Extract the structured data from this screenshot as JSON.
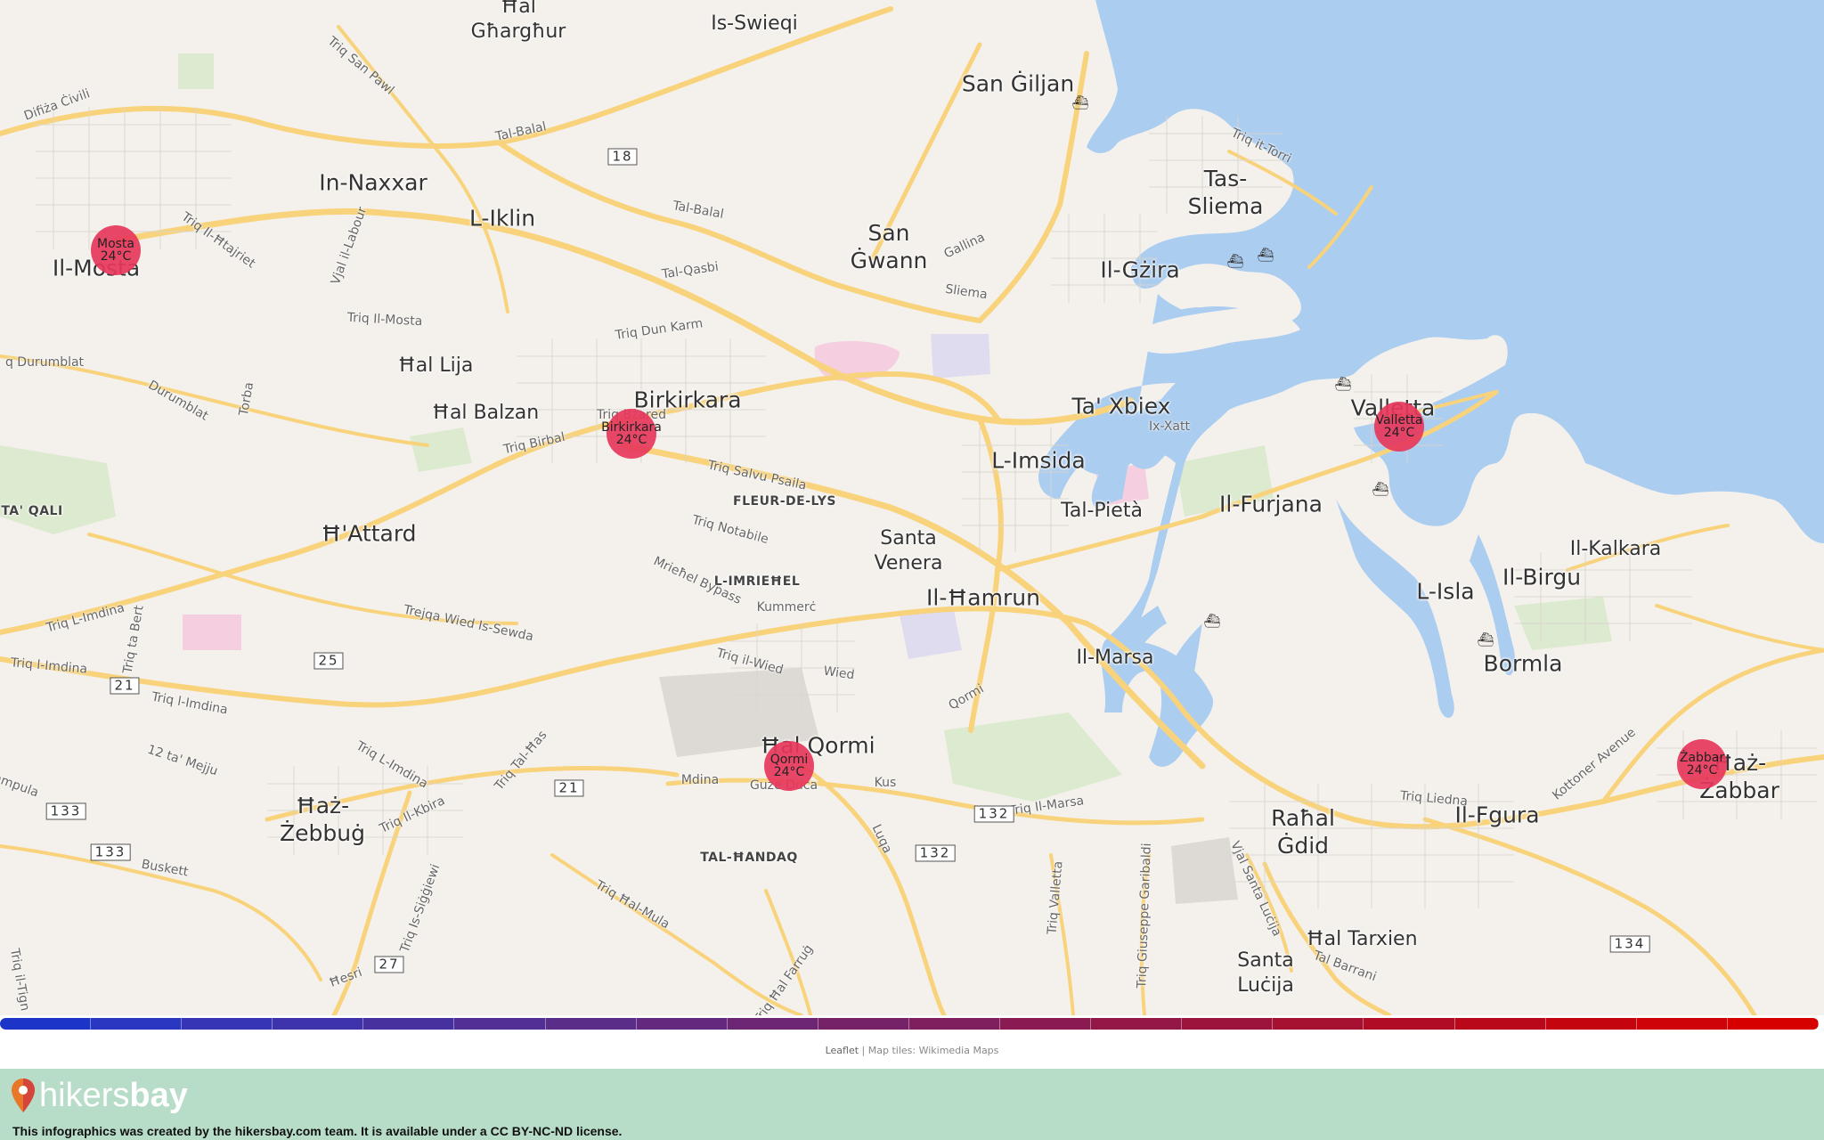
{
  "map": {
    "places": [
      {
        "id": "hal-gharghur",
        "text": "Ħal\nGħargħur",
        "size": "mid"
      },
      {
        "id": "is-swieqi",
        "text": "Is-Swieqi",
        "size": "mid"
      },
      {
        "id": "san-giljan",
        "text": "San Ġiljan",
        "size": "big"
      },
      {
        "id": "in-naxxar",
        "text": "In-Naxxar",
        "size": "big"
      },
      {
        "id": "l-iklin",
        "text": "L-Iklin",
        "size": "big"
      },
      {
        "id": "tas-sliema",
        "text": "Tas-\nSliema",
        "size": "big"
      },
      {
        "id": "san-gwann",
        "text": "San\nĠwann",
        "size": "big"
      },
      {
        "id": "il-gzira",
        "text": "Il-Gżira",
        "size": "big"
      },
      {
        "id": "il-mosta",
        "text": "Il-Mosta",
        "size": "big"
      },
      {
        "id": "hal-lija",
        "text": "Ħal Lija",
        "size": "mid"
      },
      {
        "id": "hal-balzan",
        "text": "Ħal Balzan",
        "size": "mid"
      },
      {
        "id": "birkirkara",
        "text": "Birkirkara",
        "size": "big"
      },
      {
        "id": "ta-xbiex",
        "text": "Ta' Xbiex",
        "size": "big"
      },
      {
        "id": "valletta",
        "text": "Valletta",
        "size": "big"
      },
      {
        "id": "l-imsida",
        "text": "L-Imsida",
        "size": "big"
      },
      {
        "id": "tal-pieta",
        "text": "Tal-Pietà",
        "size": "mid"
      },
      {
        "id": "il-furjana",
        "text": "Il-Furjana",
        "size": "big"
      },
      {
        "id": "h-attard",
        "text": "Ħ'Attard",
        "size": "big"
      },
      {
        "id": "santa-venera",
        "text": "Santa\nVenera",
        "size": "mid"
      },
      {
        "id": "il-hamrun",
        "text": "Il-Ħamrun",
        "size": "big"
      },
      {
        "id": "il-kalkara",
        "text": "Il-Kalkara",
        "size": "mid"
      },
      {
        "id": "il-birgu",
        "text": "Il-Birgu",
        "size": "big"
      },
      {
        "id": "l-isla",
        "text": "L-Isla",
        "size": "big"
      },
      {
        "id": "il-marsa",
        "text": "Il-Marsa",
        "size": "mid"
      },
      {
        "id": "bormla",
        "text": "Bormla",
        "size": "big"
      },
      {
        "id": "hal-qormi",
        "text": "Ħal Qormi",
        "size": "big"
      },
      {
        "id": "haz-zabbar",
        "text": "Ħaż-\nŻabbar",
        "size": "big"
      },
      {
        "id": "haz-zebbug",
        "text": "Ħaż-\nŻebbuġ",
        "size": "big"
      },
      {
        "id": "rahal-gdid",
        "text": "Raħal\nĠdid",
        "size": "big"
      },
      {
        "id": "il-fgura",
        "text": "Il-Fgura",
        "size": "big"
      },
      {
        "id": "hal-tarxien",
        "text": "Ħal Tarxien",
        "size": "mid"
      },
      {
        "id": "santa-lucija",
        "text": "Santa\nLuċija",
        "size": "mid"
      },
      {
        "id": "ta-qali",
        "text": "TA' QALI",
        "size": "small"
      },
      {
        "id": "fleur-de-lys",
        "text": "FLEUR-DE-LYS",
        "size": "small"
      },
      {
        "id": "l-imriehel",
        "text": "L-IMRIEĦEL",
        "size": "small"
      },
      {
        "id": "tal-handaq",
        "text": "TAL-ĦANDAQ",
        "size": "small"
      }
    ],
    "streets": [
      {
        "id": "difiza-civili",
        "text": "Difiża Ċivili",
        "rot": -20
      },
      {
        "id": "triq-san-pawl",
        "text": "Triq San Pawl",
        "rot": 40
      },
      {
        "id": "tal-balal-1",
        "text": "Tal-Balal",
        "rot": -12
      },
      {
        "id": "triq-it-torri",
        "text": "Triq it-Torri",
        "rot": 25
      },
      {
        "id": "triq-il-htajriet",
        "text": "Triq Il-Ħtajriet",
        "rot": 35
      },
      {
        "id": "vjal-il-labour",
        "text": "Vjal il-Labour",
        "rot": -70
      },
      {
        "id": "tal-balal-2",
        "text": "Tal-Balal",
        "rot": 10
      },
      {
        "id": "gallina",
        "text": "Gallina",
        "rot": -25
      },
      {
        "id": "tal-qasbi",
        "text": "Tal-Qasbi",
        "rot": -8
      },
      {
        "id": "sliema-road",
        "text": "Sliema",
        "rot": 8
      },
      {
        "id": "triq-il-mosta",
        "text": "Triq Il-Mosta",
        "rot": 3
      },
      {
        "id": "triq-dun-karm",
        "text": "Triq Dun Karm",
        "rot": -8
      },
      {
        "id": "durumblat-1",
        "text": "q Durumblat",
        "rot": 0
      },
      {
        "id": "durumblat-2",
        "text": "Durumblat",
        "rot": 30
      },
      {
        "id": "torba",
        "text": "Torba",
        "rot": -80
      },
      {
        "id": "triq-birbal",
        "text": "Triq Birbal",
        "rot": -12
      },
      {
        "id": "triq-bzared",
        "text": "Triq Bżared",
        "rot": 0
      },
      {
        "id": "triq-salvu-psaila",
        "text": "Triq Salvu Psaila",
        "rot": 12
      },
      {
        "id": "ix-xatt",
        "text": "Ix-Xatt",
        "rot": 0
      },
      {
        "id": "triq-notabile",
        "text": "Triq Notabile",
        "rot": 15
      },
      {
        "id": "mriehel-bypass",
        "text": "Mrieħel Bypass",
        "rot": 25
      },
      {
        "id": "kummerc",
        "text": "Kummerċ",
        "rot": 0
      },
      {
        "id": "trejqa-wied",
        "text": "Trejqa Wied Is-Sewda",
        "rot": 12
      },
      {
        "id": "triq-l-imdina-1",
        "text": "Triq L-Imdina",
        "rot": -15
      },
      {
        "id": "triq-ta-berta",
        "text": "Triq ta Bert",
        "rot": -80
      },
      {
        "id": "triq-l-imdina-2",
        "text": "Triq l-Imdina",
        "rot": 5
      },
      {
        "id": "triq-l-imdina-3",
        "text": "Triq l-Imdina",
        "rot": 10
      },
      {
        "id": "triq-il-wied",
        "text": "Triq il-Wied",
        "rot": 15
      },
      {
        "id": "wied",
        "text": "Wied",
        "rot": 8
      },
      {
        "id": "qormi-road",
        "text": "Qormi",
        "rot": -30
      },
      {
        "id": "ta-mejju",
        "text": "12 ta' Mejju",
        "rot": 18
      },
      {
        "id": "triq-l-imdina-4",
        "text": "Triq L-Imdina",
        "rot": 30
      },
      {
        "id": "triq-tal-has",
        "text": "Triq Tal-Ħas",
        "rot": -50
      },
      {
        "id": "mdina",
        "text": "Mdina",
        "rot": 0
      },
      {
        "id": "guze-duca",
        "text": "Guże Duca",
        "rot": 0
      },
      {
        "id": "kus",
        "text": "Kus",
        "rot": 0
      },
      {
        "id": "triq-liedna",
        "text": "Triq Liedna",
        "rot": 5
      },
      {
        "id": "kottoner",
        "text": "Kottoner Avenue",
        "rot": -40
      },
      {
        "id": "triq-il-kbira",
        "text": "Triq Il-Kbira",
        "rot": -25
      },
      {
        "id": "ampula",
        "text": "ampula",
        "rot": 20
      },
      {
        "id": "buskett",
        "text": "Buskett",
        "rot": 10
      },
      {
        "id": "triq-is-siggiewi",
        "text": "Triq Is-Siġġiewi",
        "rot": -70
      },
      {
        "id": "luqa",
        "text": "Luqa",
        "rot": 65
      },
      {
        "id": "triq-il-marsa",
        "text": "Triq Il-Marsa",
        "rot": -8
      },
      {
        "id": "triq-valletta",
        "text": "Triq Valletta",
        "rot": -85
      },
      {
        "id": "triq-giuseppe",
        "text": "Triq Giuseppe Garibaldi",
        "rot": -88
      },
      {
        "id": "vjal-santa-lucija",
        "text": "Vjal Santa Luċija",
        "rot": 65
      },
      {
        "id": "triq-hal-mula",
        "text": "Triq Ħal-Mula",
        "rot": 30
      },
      {
        "id": "triq-hal-farrug",
        "text": "Triq Ħal Farruġ",
        "rot": -55
      },
      {
        "id": "tal-barrani",
        "text": "Tal Barrani",
        "rot": 20
      },
      {
        "id": "hesri",
        "text": "Ħesri",
        "rot": -20
      },
      {
        "id": "triq-il-tign",
        "text": "Triq il-Tign",
        "rot": 80
      }
    ],
    "routes": [
      "18",
      "25",
      "21",
      "21",
      "133",
      "133",
      "27",
      "132",
      "132",
      "134"
    ],
    "markers": [
      {
        "id": "mosta",
        "name": "Mosta",
        "temp": "24°C"
      },
      {
        "id": "birkirkara",
        "name": "Birkirkara",
        "temp": "24°C"
      },
      {
        "id": "valletta",
        "name": "Valletta",
        "temp": "24°C"
      },
      {
        "id": "qormi",
        "name": "Qormi",
        "temp": "24°C"
      },
      {
        "id": "zabbar",
        "name": "Żabbar",
        "temp": "24°C"
      }
    ],
    "colors": {
      "land": "#f4f1ec",
      "sea": "#abcdf0",
      "road": "#f8d37c",
      "marker": "#e8385c",
      "colorbar": [
        "#1c35c8",
        "#2a37c0",
        "#3535b5",
        "#3e33aa",
        "#47319f",
        "#512f94",
        "#5a2d89",
        "#63297e",
        "#6c2673",
        "#762268",
        "#7f1f5d",
        "#891b52",
        "#931847",
        "#9c143c",
        "#a61031",
        "#b00c26",
        "#ba081b",
        "#c40510",
        "#cd0308",
        "#d60000"
      ]
    }
  },
  "attribution": {
    "leaflet": "Leaflet",
    "sep": " | ",
    "tiles": "Map tiles: Wikimedia Maps"
  },
  "footer": {
    "logo_part1": "hikers",
    "logo_part2": "bay",
    "license": "This infographics was created by the hikersbay.com team. It is available under a CC BY-NC-ND license."
  }
}
